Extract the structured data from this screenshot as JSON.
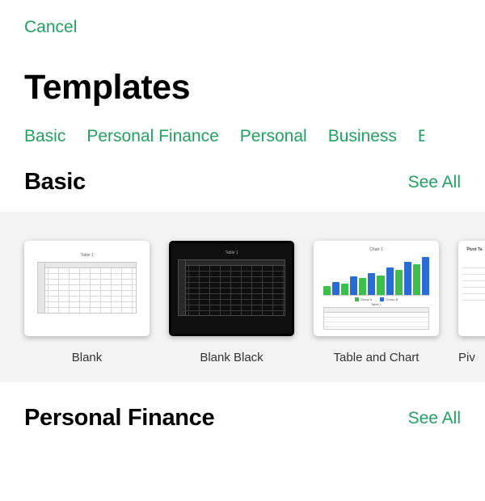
{
  "header": {
    "cancel": "Cancel",
    "title": "Templates"
  },
  "tabs": [
    "Basic",
    "Personal Finance",
    "Personal",
    "Business"
  ],
  "sections": [
    {
      "title": "Basic",
      "see_all": "See All",
      "templates": [
        {
          "label": "Blank"
        },
        {
          "label": "Blank Black"
        },
        {
          "label": "Table and Chart"
        },
        {
          "label": "Piv"
        }
      ]
    },
    {
      "title": "Personal Finance",
      "see_all": "See All"
    }
  ],
  "thumb_text": {
    "table1": "Table 1",
    "chart1": "Chart 1",
    "group_a": "Group A",
    "group_b": "Group B",
    "pivot": "Pivot Ta"
  }
}
